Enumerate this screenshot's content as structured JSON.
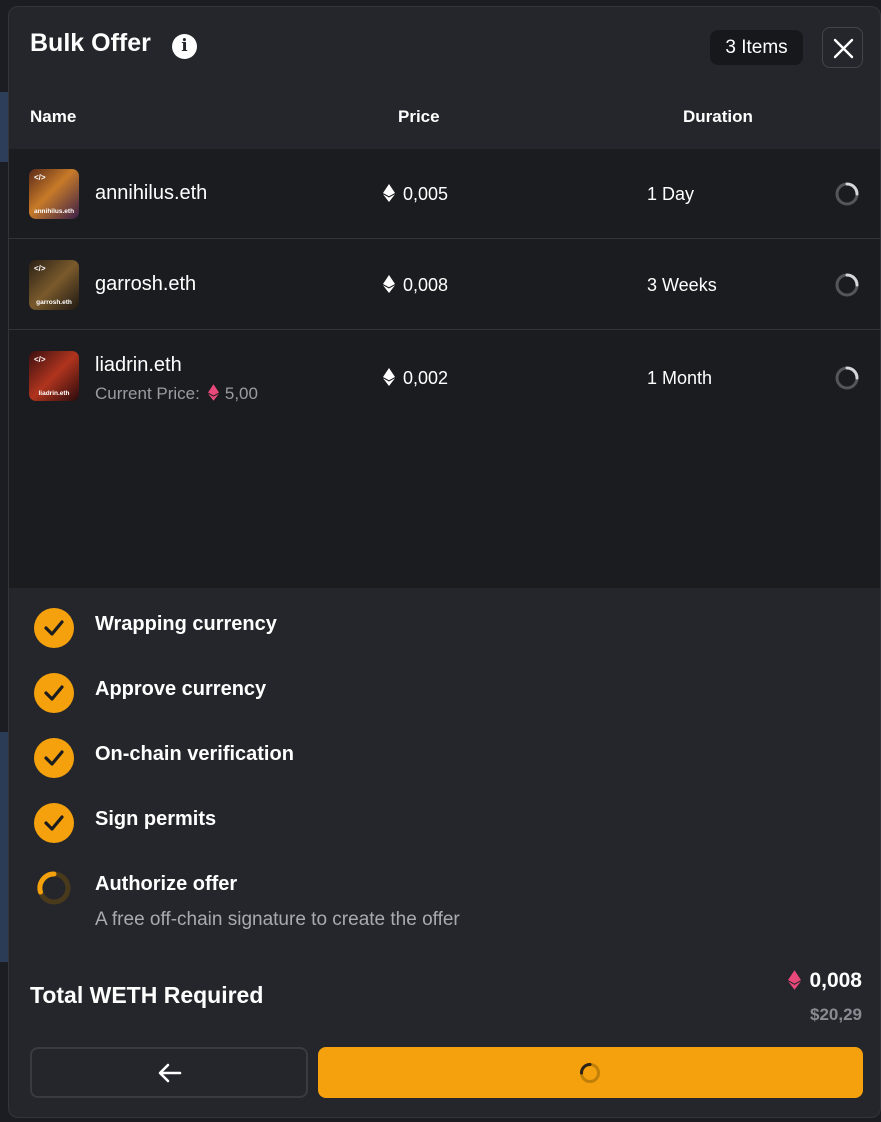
{
  "modal": {
    "title": "Bulk Offer",
    "items_badge": "3 Items"
  },
  "table": {
    "columns": [
      "Name",
      "Price",
      "Duration"
    ],
    "rows": [
      {
        "name": "annihilus.eth",
        "price": "0,005",
        "duration": "1 Day",
        "thumb_label": "annihilus.eth"
      },
      {
        "name": "garrosh.eth",
        "price": "0,008",
        "duration": "3 Weeks",
        "thumb_label": "garrosh.eth"
      },
      {
        "name": "liadrin.eth",
        "price": "0,002",
        "duration": "1 Month",
        "thumb_label": "liadrin.eth",
        "current_price_label": "Current Price:",
        "current_price": "5,00"
      }
    ]
  },
  "steps": [
    {
      "label": "Wrapping currency",
      "done": true
    },
    {
      "label": "Approve currency",
      "done": true
    },
    {
      "label": "On-chain verification",
      "done": true
    },
    {
      "label": "Sign permits",
      "done": true
    },
    {
      "label": "Authorize offer",
      "done": false,
      "description": "A free off-chain signature to create the offer"
    }
  ],
  "total": {
    "label": "Total WETH Required",
    "eth": "0,008",
    "usd": "$20,29"
  },
  "colors": {
    "accent": "#f4a10d",
    "weth_pink": "#e8497a",
    "modal_bg": "#25262b",
    "table_bg": "#1b1c1f"
  },
  "icons": {
    "info": "info-icon",
    "close": "close-icon",
    "eth": "eth-icon",
    "weth": "weth-icon",
    "check": "check-icon",
    "spinner": "spinner-icon",
    "back": "arrow-left-icon"
  }
}
